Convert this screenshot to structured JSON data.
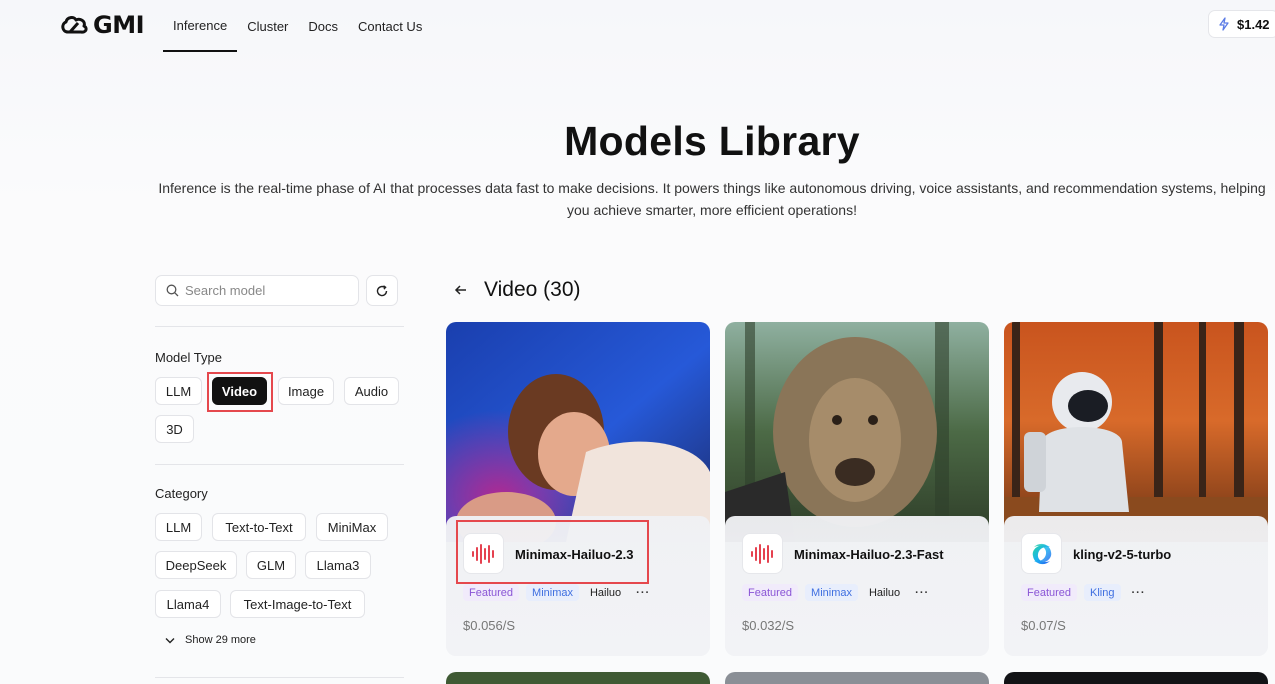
{
  "nav": {
    "logo": "GMI",
    "links": [
      "Inference",
      "Cluster",
      "Docs",
      "Contact Us"
    ],
    "balance": "$1.42"
  },
  "hero": {
    "title": "Models Library",
    "description": "Inference is the real-time phase of AI that processes data fast to make decisions. It powers things like autonomous driving, voice assistants, and recommendation systems, helping you achieve smarter, more efficient operations!"
  },
  "sidebar": {
    "search_placeholder": "Search model",
    "model_type_label": "Model Type",
    "model_types": [
      "LLM",
      "Video",
      "Image",
      "Audio",
      "3D"
    ],
    "selected_model_type": "Video",
    "category_label": "Category",
    "categories": [
      "LLM",
      "Text-to-Text",
      "MiniMax",
      "DeepSeek",
      "GLM",
      "Llama3",
      "Llama4",
      "Text-Image-to-Text"
    ],
    "show_more": "Show 29 more"
  },
  "main": {
    "title": "Video (30)",
    "cards": [
      {
        "name": "Minimax-Hailuo-2.3",
        "tags": [
          "Featured",
          "Minimax",
          "Hailuo"
        ],
        "more": "···",
        "price": "$0.056/S",
        "icon": "minimax-waveform-icon"
      },
      {
        "name": "Minimax-Hailuo-2.3-Fast",
        "tags": [
          "Featured",
          "Minimax",
          "Hailuo"
        ],
        "more": "···",
        "price": "$0.032/S",
        "icon": "minimax-waveform-icon"
      },
      {
        "name": "kling-v2-5-turbo",
        "tags": [
          "Featured",
          "Kling"
        ],
        "more": "···",
        "price": "$0.07/S",
        "icon": "kling-swirl-icon"
      }
    ]
  },
  "colors": {
    "accent": "#111111",
    "highlight": "#e5484d",
    "featured": "#8a55d6",
    "vendor": "#3f6fe0"
  }
}
